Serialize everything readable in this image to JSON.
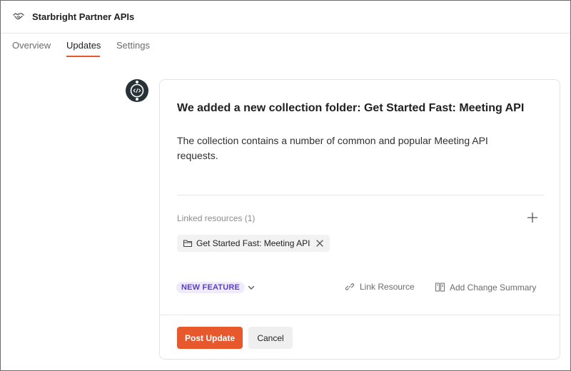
{
  "header": {
    "title": "Starbright Partner APIs",
    "logo_icon": "handshake-icon"
  },
  "tabs": [
    {
      "label": "Overview",
      "active": false
    },
    {
      "label": "Updates",
      "active": true
    },
    {
      "label": "Settings",
      "active": false
    }
  ],
  "update": {
    "avatar_icon": "code-avatar-icon",
    "title": "We added a new collection folder: Get Started Fast: Meeting API",
    "body": "The collection contains a number of common and popular Meeting API requests.",
    "linked_resources_label": "Linked resources (1)",
    "linked_resources": [
      {
        "label": "Get Started Fast: Meeting API",
        "icon": "folder-icon"
      }
    ],
    "type_badge": "NEW FEATURE",
    "link_resource_label": "Link Resource",
    "add_change_summary_label": "Add Change Summary"
  },
  "actions": {
    "post_label": "Post Update",
    "cancel_label": "Cancel"
  },
  "colors": {
    "accent": "#e8582d",
    "badge_bg": "#efeafc",
    "badge_text": "#5a3ec8",
    "avatar": "#263238"
  }
}
